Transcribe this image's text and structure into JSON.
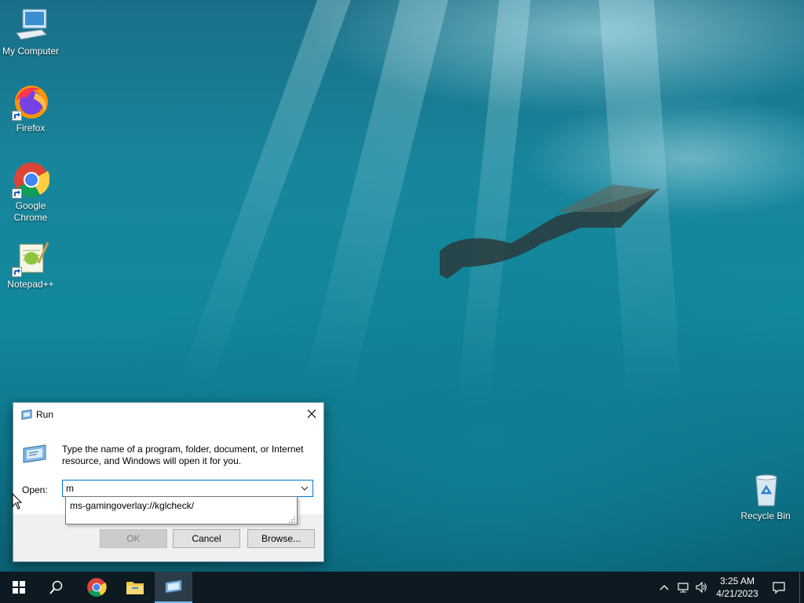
{
  "desktop": {
    "icons": [
      {
        "label": "My Computer"
      },
      {
        "label": "Firefox"
      },
      {
        "label": "Google Chrome"
      },
      {
        "label": "Notepad++"
      },
      {
        "label": "Recycle Bin"
      }
    ]
  },
  "run_dialog": {
    "title": "Run",
    "description": "Type the name of a program, folder, document, or Internet resource, and Windows will open it for you.",
    "open_label": "Open:",
    "input_value": "m",
    "autocomplete_suggestion": "ms-gamingoverlay://kglcheck/",
    "ok_label": "OK",
    "cancel_label": "Cancel",
    "browse_label": "Browse..."
  },
  "taskbar": {
    "items": [
      "start-icon",
      "search-icon",
      "chrome-icon",
      "file-explorer-icon",
      "run-icon"
    ],
    "clock_time": "3:25 AM",
    "clock_date": "4/21/2023"
  },
  "colors": {
    "taskbar_bg": "#0e1a22",
    "accent": "#0078d7"
  }
}
